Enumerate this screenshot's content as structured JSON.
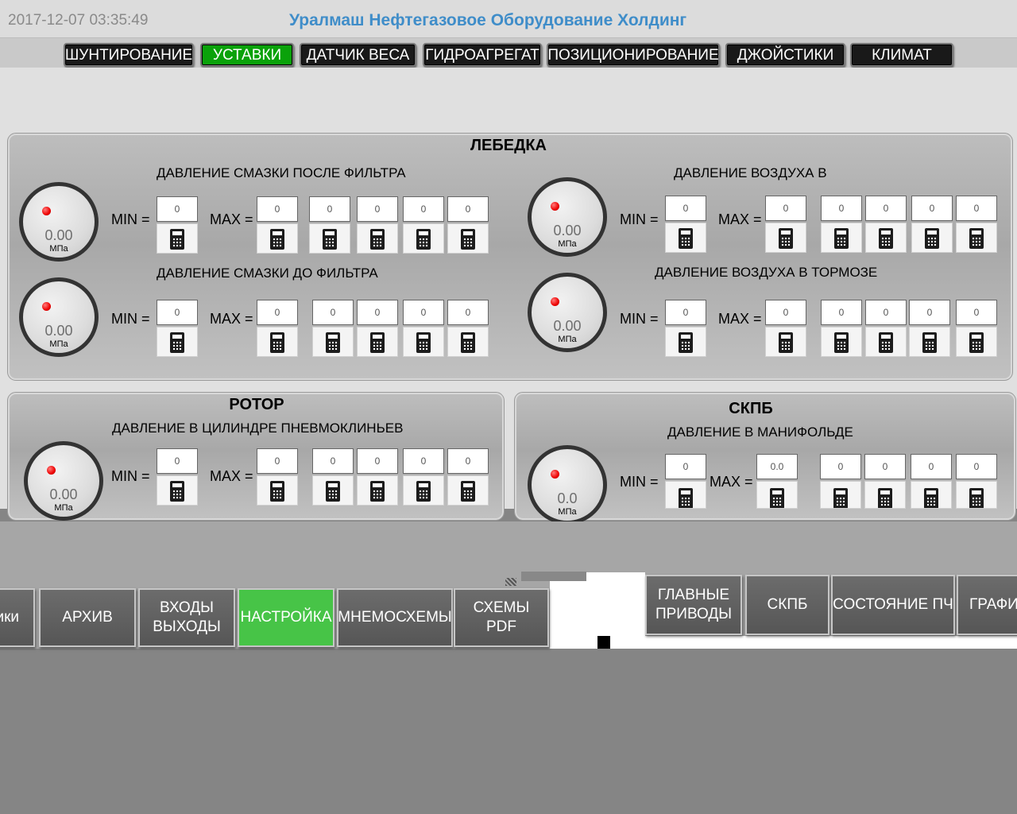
{
  "header": {
    "datetime": "2017-12-07 03:35:49",
    "company": "Уралмаш Нефтегазовое Оборудование Холдинг"
  },
  "nav": {
    "items": [
      {
        "label": "ШУНТИРОВАНИЕ",
        "active": false
      },
      {
        "label": "УСТАВКИ",
        "active": true
      },
      {
        "label": "ДАТЧИК ВЕСА",
        "active": false
      },
      {
        "label": "ГИДРОАГРЕГАТ",
        "active": false
      },
      {
        "label": "ПОЗИЦИОНИРОВАНИЕ",
        "active": false
      },
      {
        "label": "ДЖОЙСТИКИ",
        "active": false
      },
      {
        "label": "КЛИМАТ",
        "active": false
      }
    ]
  },
  "common": {
    "min_label": "MIN =",
    "max_label": "MAX =",
    "unit": "МПа",
    "calculator_icon": "calculator-icon"
  },
  "panels": {
    "lebedka": {
      "title": "ЛЕБЕДКА",
      "sensors": [
        {
          "label": "ДАВЛЕНИЕ СМАЗКИ ПОСЛЕ ФИЛЬТРА",
          "value": "0.00",
          "min": "0",
          "max": "0",
          "extra": [
            "0",
            "0",
            "0",
            "0"
          ]
        },
        {
          "label": "ДАВЛЕНИЕ СМАЗКИ ДО ФИЛЬТРА",
          "value": "0.00",
          "min": "0",
          "max": "0",
          "extra": [
            "0",
            "0",
            "0",
            "0"
          ]
        },
        {
          "label": "ДАВЛЕНИЕ ВОЗДУХА В",
          "value": "0.00",
          "min": "0",
          "max": "0",
          "extra": [
            "0",
            "0",
            "0",
            "0"
          ]
        },
        {
          "label": "ДАВЛЕНИЕ ВОЗДУХА В ТОРМОЗЕ",
          "value": "0.00",
          "min": "0",
          "max": "0",
          "extra": [
            "0",
            "0",
            "0",
            "0"
          ]
        }
      ]
    },
    "rotor": {
      "title": "РОТОР",
      "sensors": [
        {
          "label": "ДАВЛЕНИЕ В ЦИЛИНДРЕ ПНЕВМОКЛИНЬЕВ",
          "value": "0.00",
          "min": "0",
          "max": "0",
          "extra": [
            "0",
            "0",
            "0",
            "0"
          ]
        }
      ]
    },
    "skpb": {
      "title": "СКПБ",
      "sensors": [
        {
          "label": "ДАВЛЕНИЕ В МАНИФОЛЬДЕ",
          "value": "0.0",
          "min": "0",
          "max": "0.0",
          "extra": [
            "0",
            "0",
            "0",
            "0"
          ]
        }
      ]
    }
  },
  "bottom_nav_left": [
    {
      "label": "ики",
      "active": false
    },
    {
      "label": "АРХИВ",
      "active": false
    },
    {
      "label": "ВХОДЫ\nВЫХОДЫ",
      "active": false
    },
    {
      "label": "НАСТРОЙКА",
      "active": true
    },
    {
      "label": "МНЕМОСХЕМЫ",
      "active": false
    },
    {
      "label": "СХЕМЫ\nPDF",
      "active": false
    }
  ],
  "bottom_nav_right": [
    {
      "label": "ГЛАВНЫЕ\nПРИВОДЫ",
      "active": false
    },
    {
      "label": "СКПБ",
      "active": false
    },
    {
      "label": "СОСТОЯНИЕ ПЧ",
      "active": false
    },
    {
      "label": "ГРАФИ",
      "active": false
    }
  ]
}
